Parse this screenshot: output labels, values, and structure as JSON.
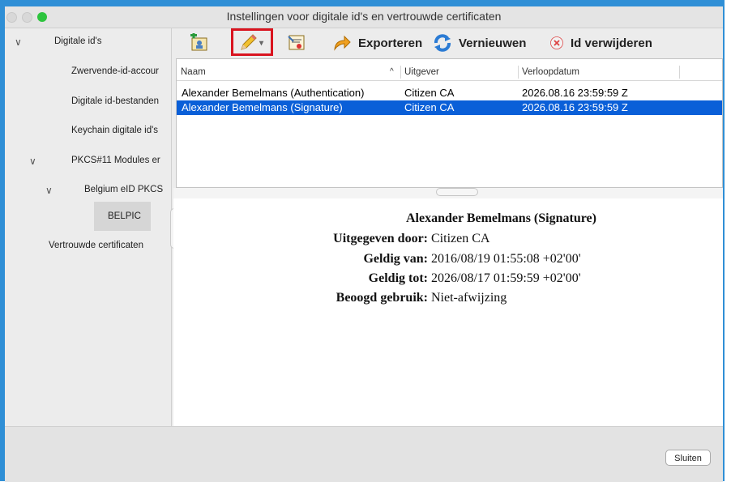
{
  "window": {
    "title": "Instellingen voor digitale id's en vertrouwde certificaten"
  },
  "sidebar": {
    "items": [
      {
        "label": "Digitale id's",
        "expanded": true
      },
      {
        "label": "Zwervende-id-accour"
      },
      {
        "label": "Digitale id-bestanden"
      },
      {
        "label": "Keychain digitale id's"
      },
      {
        "label": "PKCS#11 Modules er",
        "expanded": true
      },
      {
        "label": "Belgium eID PKCS",
        "expanded": true
      },
      {
        "label": "BELPIC",
        "selected": true
      },
      {
        "label": "Vertrouwde certificaten"
      }
    ]
  },
  "toolbar": {
    "icons": [
      "add-id-icon",
      "pencil-icon",
      "certificate-icon",
      "export-arrow-icon",
      "refresh-icon",
      "delete-x-icon"
    ],
    "export_label": "Exporteren",
    "refresh_label": "Vernieuwen",
    "delete_label": "Id verwijderen"
  },
  "table": {
    "columns": [
      "Naam",
      "Uitgever",
      "Verloopdatum"
    ],
    "sort_indicator": "^",
    "rows": [
      {
        "name": "Alexander Bemelmans (Authentication)",
        "issuer": "Citizen CA",
        "expires": "2026.08.16 23:59:59 Z",
        "selected": false
      },
      {
        "name": "Alexander Bemelmans (Signature)",
        "issuer": "Citizen CA",
        "expires": "2026.08.16 23:59:59 Z",
        "selected": true
      }
    ]
  },
  "detail": {
    "title": "Alexander Bemelmans (Signature)",
    "fields": [
      {
        "label": "Uitgegeven door:",
        "value": "Citizen CA"
      },
      {
        "label": "Geldig van:",
        "value": "2016/08/19 01:55:08 +02'00'"
      },
      {
        "label": "Geldig tot:",
        "value": "2026/08/17 01:59:59 +02'00'"
      },
      {
        "label": "Beoogd gebruik:",
        "value": "Niet-afwijzing"
      }
    ]
  },
  "footer": {
    "close_label": "Sluiten"
  },
  "colors": {
    "accent_frame": "#2f8fd6",
    "selection": "#0a5fd8",
    "highlight_box": "#d9141f"
  }
}
